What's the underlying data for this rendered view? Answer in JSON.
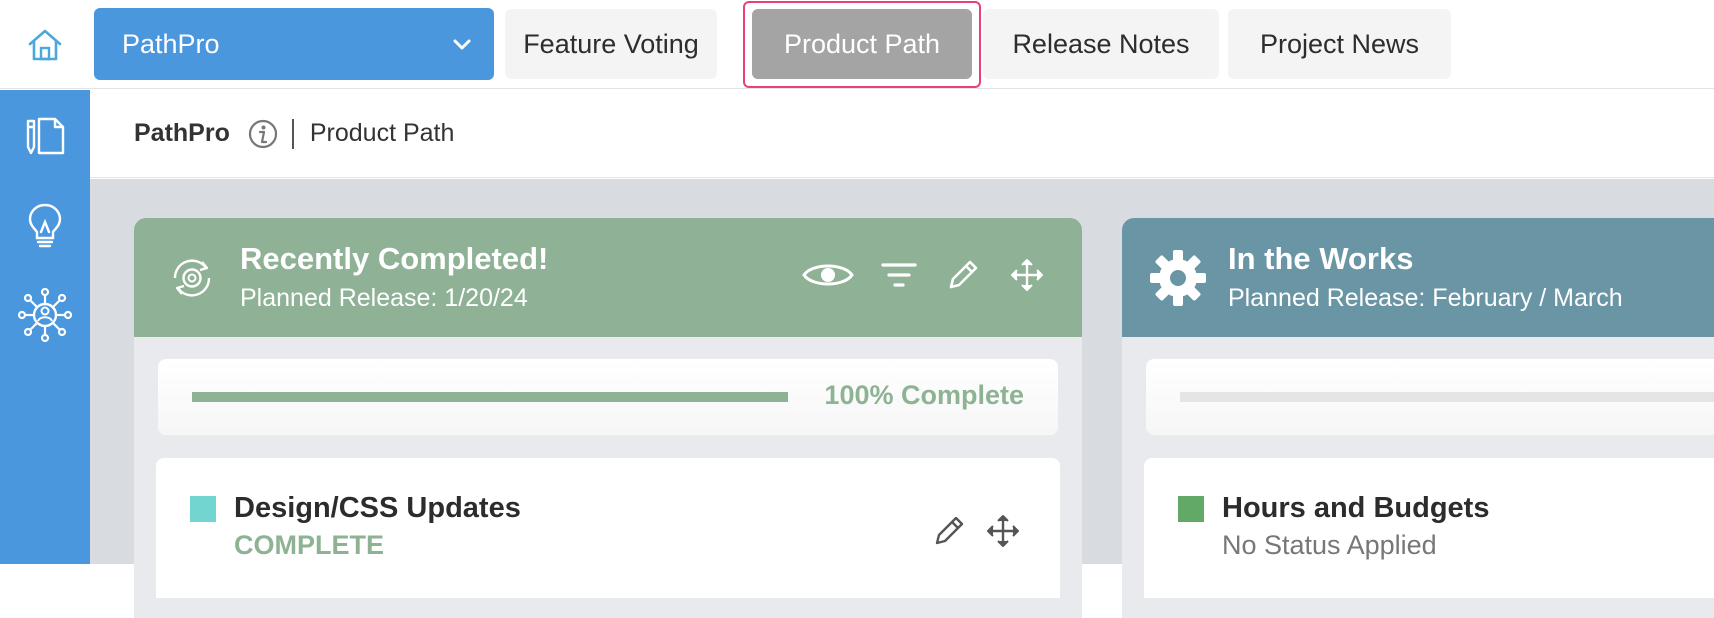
{
  "app": {
    "project_name": "PathPro",
    "tabs": [
      {
        "label": "Feature Voting",
        "active": false
      },
      {
        "label": "Product Path",
        "active": true
      },
      {
        "label": "Release Notes",
        "active": false
      },
      {
        "label": "Project News",
        "active": false
      }
    ]
  },
  "sidebar": {
    "items": [
      {
        "icon": "notes-pencil-icon"
      },
      {
        "icon": "lightbulb-icon"
      },
      {
        "icon": "network-icon"
      }
    ]
  },
  "breadcrumb": {
    "root": "PathPro",
    "page": "Product Path"
  },
  "columns": [
    {
      "title": "Recently Completed!",
      "subtitle": "Planned Release: 1/20/24",
      "header_color": "#8fb296",
      "icon": "gear-cycle-icon",
      "progress_percent": 100,
      "progress_label": "100% Complete",
      "items": [
        {
          "title": "Design/CSS Updates",
          "status": "COMPLETE",
          "swatch": "#72d5cf",
          "status_color": "#8eb394"
        }
      ]
    },
    {
      "title": "In the Works",
      "subtitle": "Planned Release: February / March",
      "header_color": "#6a95a5",
      "icon": "gear-icon",
      "progress_percent": 0,
      "items": [
        {
          "title": "Hours and Budgets",
          "status": "No Status Applied",
          "swatch": "#62a866",
          "status_color": "#777777"
        }
      ]
    }
  ]
}
